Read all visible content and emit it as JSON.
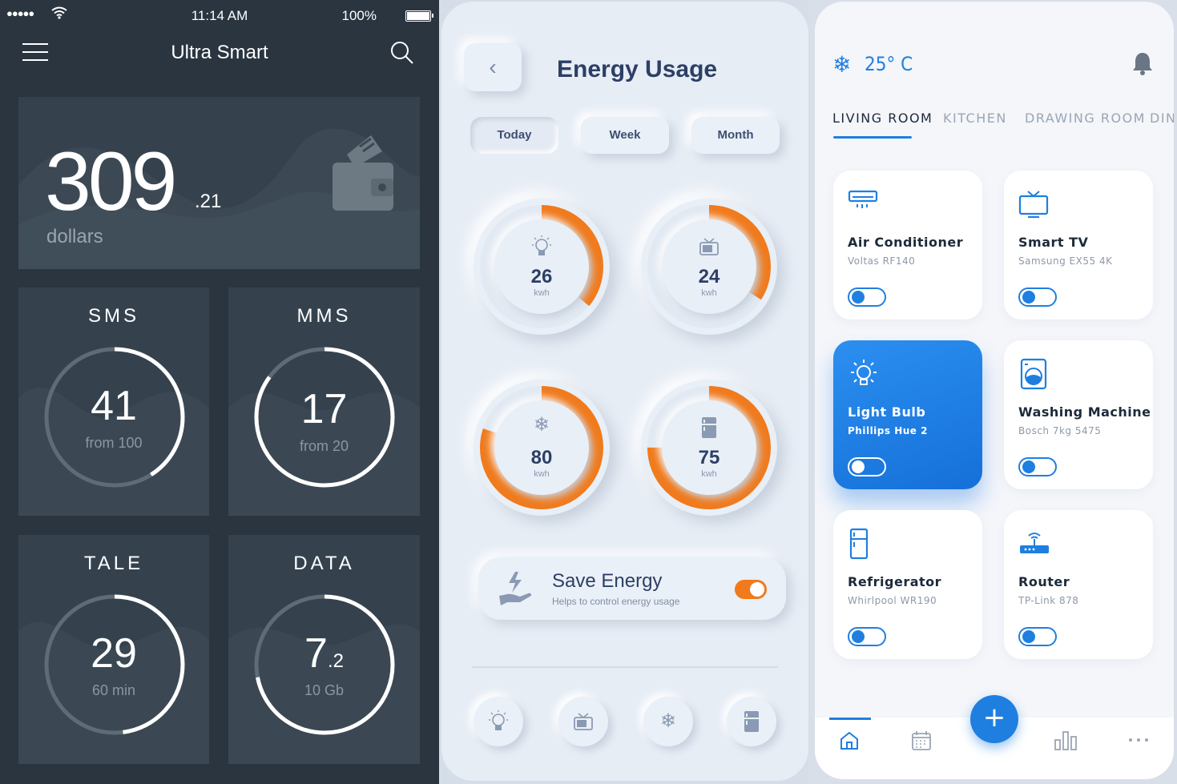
{
  "panel1": {
    "status": {
      "signal": "●●●●●",
      "time": "11:14 AM",
      "battery": "100%"
    },
    "title": "Ultra Smart",
    "balance": {
      "value": "309",
      "decimal": ".21",
      "unit": "dollars"
    },
    "stats": [
      {
        "title": "SMS",
        "value": "41",
        "sub": "from 100",
        "progress": 0.41
      },
      {
        "title": "MMS",
        "value": "17",
        "sub": "from 20",
        "progress": 0.85
      },
      {
        "title": "TALE",
        "value": "29",
        "sub": "60 min",
        "progress": 0.48
      },
      {
        "title": "DATA",
        "value": "7",
        "decimal": ".2",
        "sub": "10 Gb",
        "progress": 0.72
      }
    ]
  },
  "panel2": {
    "back": "‹",
    "heading": "Energy Usage",
    "tabs": [
      "Today",
      "Week",
      "Month"
    ],
    "active_tab": "Today",
    "gauges": [
      {
        "icon": "bulb-icon",
        "value": "26",
        "unit": "kwh",
        "progress": 0.36
      },
      {
        "icon": "tv-icon",
        "value": "24",
        "unit": "kwh",
        "progress": 0.34
      },
      {
        "icon": "snowflake-icon",
        "value": "80",
        "unit": "kwh",
        "progress": 0.8
      },
      {
        "icon": "fridge-icon",
        "value": "75",
        "unit": "kwh",
        "progress": 0.75
      }
    ],
    "save": {
      "title": "Save Energy",
      "subtitle": "Helps to control energy usage",
      "enabled": true
    },
    "accent": "#f07a1c"
  },
  "panel3": {
    "temperature": "25° C",
    "rooms": [
      "LIVING ROOM",
      "KITCHEN",
      "DRAWING ROOM",
      "DINI"
    ],
    "active_room": "LIVING ROOM",
    "devices": [
      {
        "name": "Air Conditioner",
        "model": "Voltas RF140",
        "icon": "air-conditioner-icon",
        "on": false
      },
      {
        "name": "Smart TV",
        "model": "Samsung EX55 4K",
        "icon": "tv-icon",
        "on": false
      },
      {
        "name": "Light Bulb",
        "model": "Phillips Hue 2",
        "icon": "bulb-icon",
        "on": true
      },
      {
        "name": "Washing Machine",
        "model": "Bosch 7kg 5475",
        "icon": "washing-machine-icon",
        "on": false
      },
      {
        "name": "Refrigerator",
        "model": "Whirlpool WR190",
        "icon": "fridge-icon",
        "on": false
      },
      {
        "name": "Router",
        "model": "TP-Link 878",
        "icon": "router-icon",
        "on": false
      }
    ],
    "fab": "+",
    "accent": "#1f7fe0"
  }
}
